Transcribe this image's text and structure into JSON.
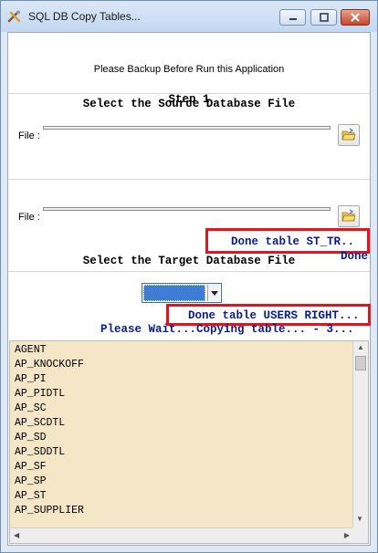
{
  "window": {
    "title": "SQL DB Copy Tables..."
  },
  "hint": "Please Backup Before Run this Application",
  "step1": {
    "overlay_title": "Step 1",
    "heading": "Select the Source Database File",
    "file_label": "File :"
  },
  "step2": {
    "file_label": "File :",
    "heading": "Select the Target Database File",
    "done_label": "Done"
  },
  "status": {
    "box1_text": "Done table ST_TR..",
    "box2_text": "Done table USERS RIGHT...",
    "progress_text": "Please Wait...Copying table... - 3..."
  },
  "tables": [
    "AGENT",
    "AP_KNOCKOFF",
    "AP_PI",
    "AP_PIDTL",
    "AP_SC",
    "AP_SCDTL",
    "AP_SD",
    "AP_SDDTL",
    "AP_SF",
    "AP_SP",
    "AP_ST",
    "AP_SUPPLIER"
  ],
  "colors": {
    "status_text": "#0a1d8c",
    "highlight_border": "#e3141b",
    "list_bg": "#f5e6c8"
  },
  "icons": {
    "app": "tools-icon",
    "browse": "open-folder-icon"
  }
}
